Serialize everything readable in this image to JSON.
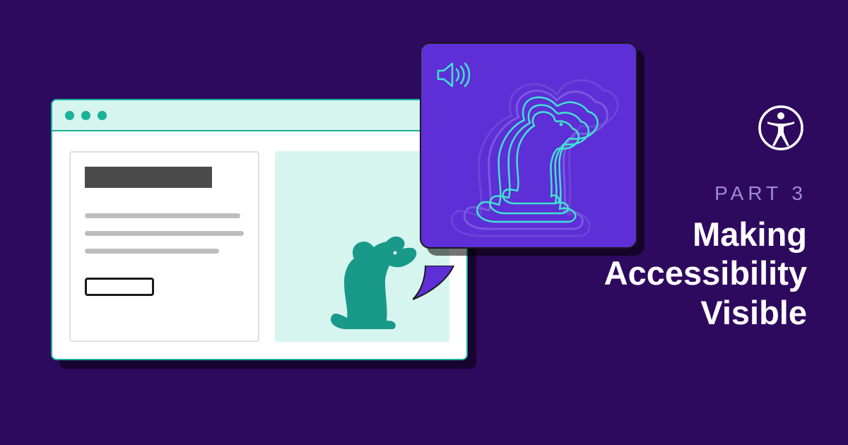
{
  "colors": {
    "background": "#2e0a5e",
    "teal": "#19b29a",
    "tealLight": "#d6f5ef",
    "speechPurple": "#5e2ed6",
    "cyanStroke": "#3fe3d0",
    "textMuted": "#a08ad0",
    "white": "#ffffff",
    "gray": "#bdbdbd",
    "darkGray": "#4a4a4a"
  },
  "text": {
    "eyebrow": "PART 3",
    "headline_line1": "Making",
    "headline_line2": "Accessibility",
    "headline_line3": "Visible"
  },
  "icons": {
    "windowDots": 3,
    "speaker": "speaker-icon",
    "accessibility": "accessibility-icon",
    "dog": "dog-icon"
  }
}
